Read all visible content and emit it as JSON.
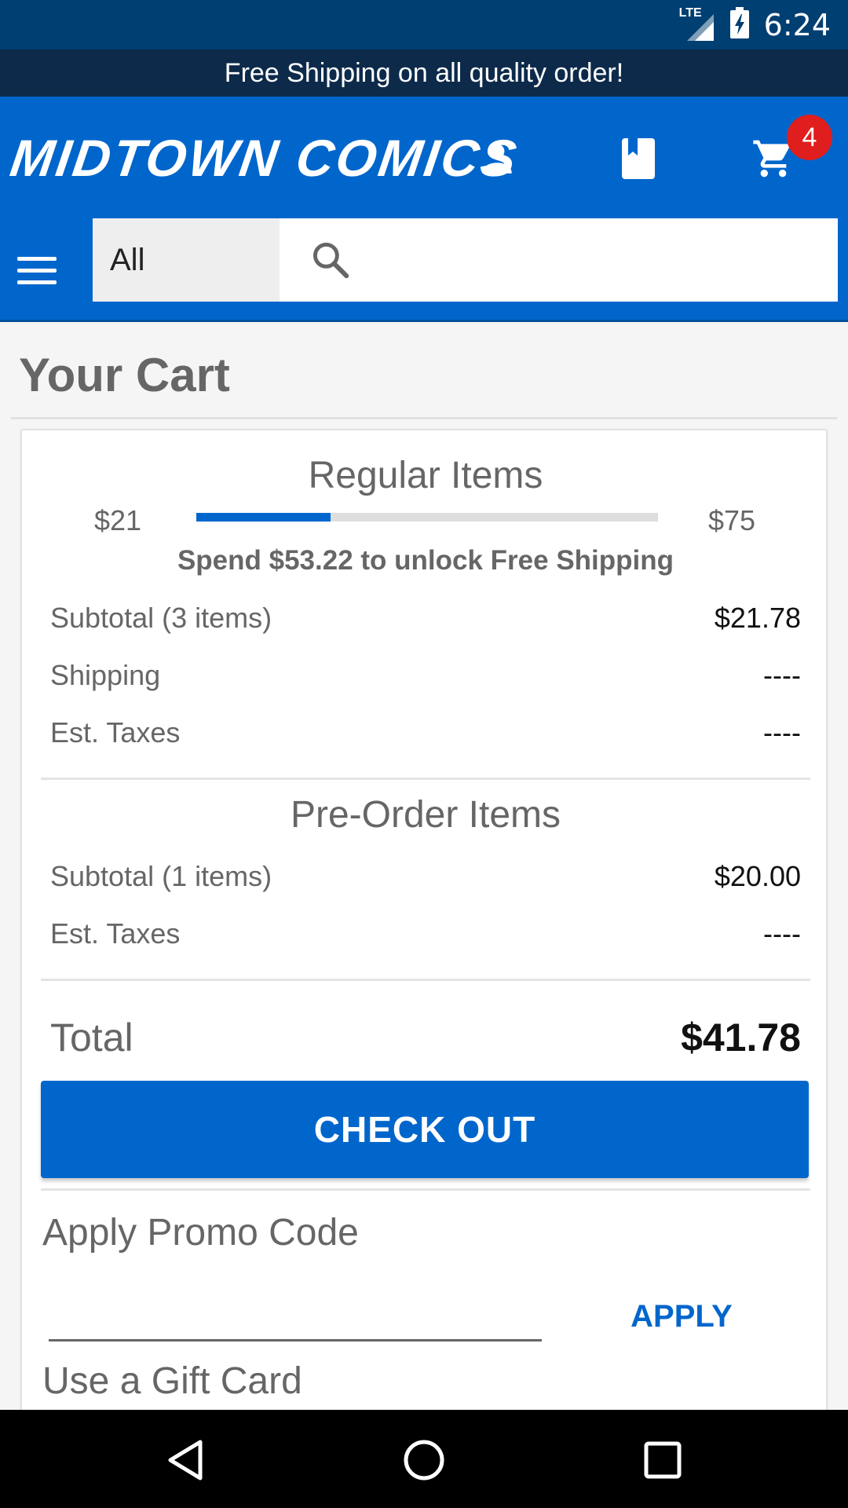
{
  "status_bar": {
    "time": "6:24",
    "network": "LTE"
  },
  "banner": {
    "text": "Free Shipping on all quality order!"
  },
  "header": {
    "logo": "MIDTOWN COMICS",
    "cart_count": "4",
    "icons": [
      "account-icon",
      "bookmark-icon",
      "cart-icon"
    ]
  },
  "search": {
    "category": "All",
    "placeholder": ""
  },
  "page": {
    "title": "Your Cart"
  },
  "regular": {
    "heading": "Regular Items",
    "progress_min": "$21",
    "progress_max": "$75",
    "progress_fraction": 0.29,
    "unlock_text": "Spend $53.22 to unlock Free Shipping",
    "rows": [
      {
        "label": "Subtotal (3 items)",
        "value": "$21.78"
      },
      {
        "label": "Shipping",
        "value": "----"
      },
      {
        "label": "Est. Taxes",
        "value": "----"
      }
    ]
  },
  "preorder": {
    "heading": "Pre-Order Items",
    "rows": [
      {
        "label": "Subtotal (1 items)",
        "value": "$20.00"
      },
      {
        "label": "Est. Taxes",
        "value": "----"
      }
    ]
  },
  "total": {
    "label": "Total",
    "value": "$41.78"
  },
  "checkout": {
    "label": "CHECK OUT"
  },
  "promo": {
    "heading": "Apply Promo Code",
    "input_value": "",
    "apply_label": "APPLY"
  },
  "gift_card": {
    "heading": "Use a Gift Card"
  },
  "colors": {
    "brand_blue": "#0066cc",
    "status_bar": "#003f72",
    "banner": "#0d2a4a",
    "badge_red": "#e01e1e"
  }
}
